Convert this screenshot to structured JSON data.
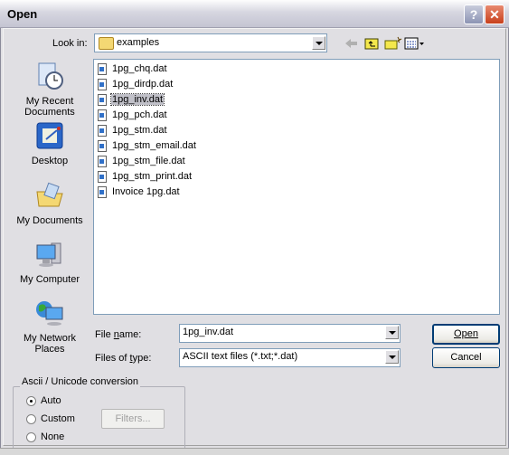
{
  "window": {
    "title": "Open",
    "help_label": "?",
    "close_label": "✕"
  },
  "look_in": {
    "label": "Look in:",
    "value": "examples",
    "icon": "folder-icon"
  },
  "toolbar": {
    "icons": [
      "back-arrow-icon",
      "up-folder-icon",
      "new-folder-icon",
      "view-menu-icon"
    ]
  },
  "places": [
    {
      "label": "My Recent Documents",
      "icon": "recent-documents-icon"
    },
    {
      "label": "Desktop",
      "icon": "desktop-icon"
    },
    {
      "label": "My Documents",
      "icon": "my-documents-icon"
    },
    {
      "label": "My Computer",
      "icon": "my-computer-icon"
    },
    {
      "label": "My Network Places",
      "icon": "network-places-icon"
    }
  ],
  "files": [
    "1pg_chq.dat",
    "1pg_dirdp.dat",
    "1pg_inv.dat",
    "1pg_pch.dat",
    "1pg_stm.dat",
    "1pg_stm_email.dat",
    "1pg_stm_file.dat",
    "1pg_stm_print.dat",
    "Invoice 1pg.dat"
  ],
  "selected_file": "1pg_inv.dat",
  "file_name": {
    "label": "File name:",
    "value": "1pg_inv.dat"
  },
  "file_type": {
    "label": "Files of type:",
    "value": "ASCII text files (*.txt;*.dat)"
  },
  "buttons": {
    "open": "Open",
    "cancel": "Cancel",
    "filters": "Filters..."
  },
  "conversion": {
    "title": "Ascii / Unicode conversion",
    "options": [
      "Auto",
      "Custom",
      "None"
    ],
    "selected": "Auto"
  }
}
